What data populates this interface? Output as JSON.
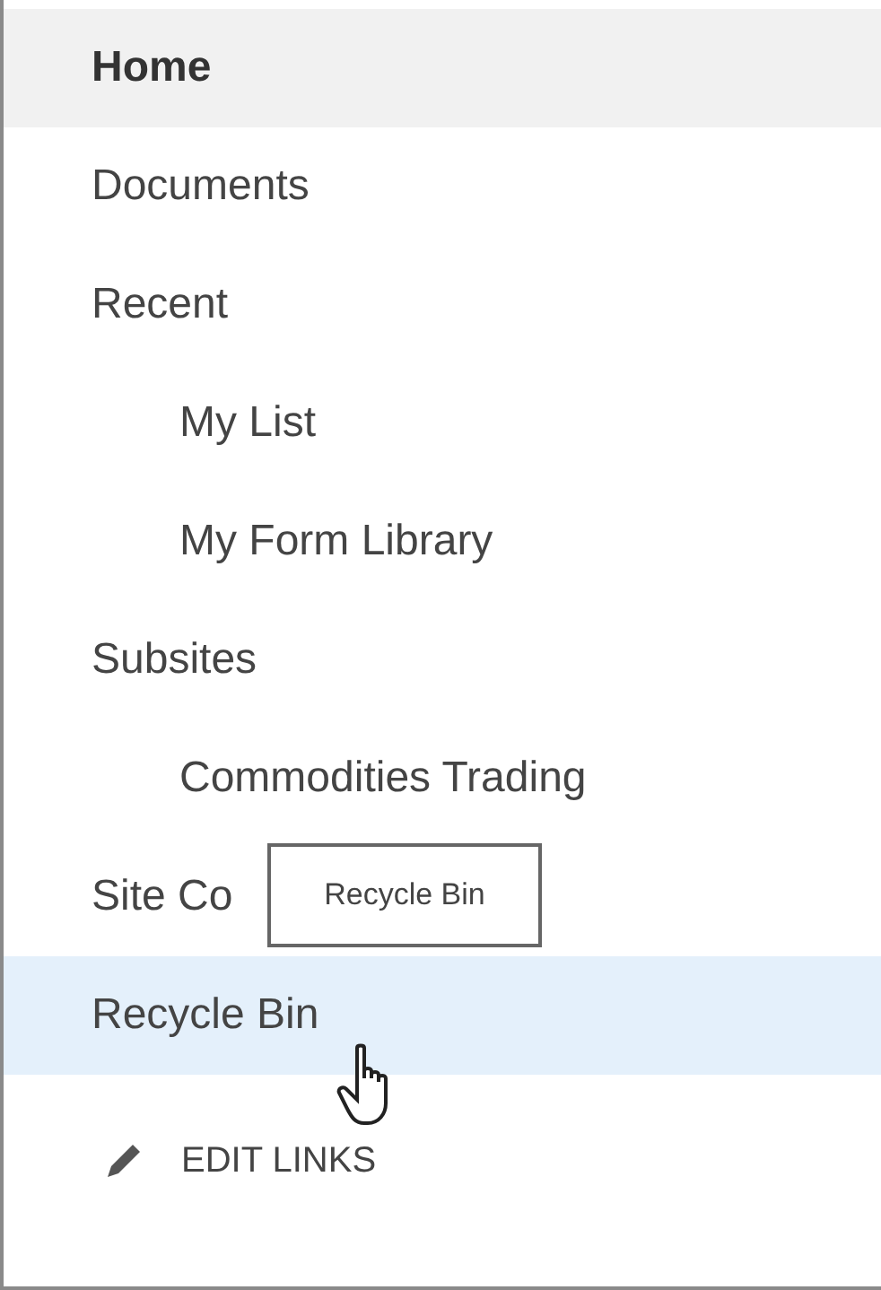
{
  "nav": [
    {
      "label": "Home",
      "selected": true,
      "hovered": false
    },
    {
      "label": "Documents",
      "selected": false,
      "hovered": false
    },
    {
      "label": "Recent",
      "selected": false,
      "hovered": false,
      "children": [
        {
          "label": "My List",
          "selected": false,
          "hovered": false
        },
        {
          "label": "My Form Library",
          "selected": false,
          "hovered": false
        }
      ]
    },
    {
      "label": "Subsites",
      "selected": false,
      "hovered": false,
      "children": [
        {
          "label": "Commodities Trading",
          "selected": false,
          "hovered": false
        }
      ]
    },
    {
      "label": "Site Co",
      "selected": false,
      "hovered": false
    },
    {
      "label": "Recycle Bin",
      "selected": false,
      "hovered": true
    }
  ],
  "tooltip": {
    "text": "Recycle Bin"
  },
  "edit_links": "EDIT LINKS"
}
